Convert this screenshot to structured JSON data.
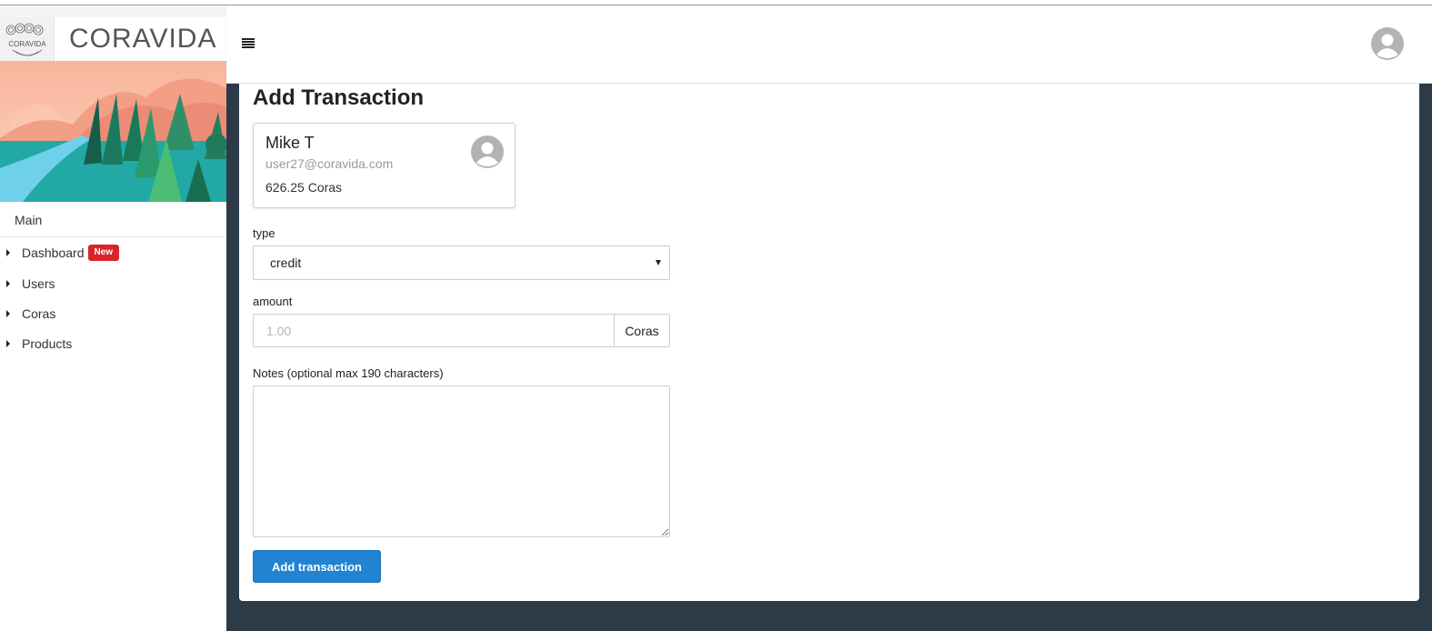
{
  "brand": {
    "title": "CORAVIDA",
    "logo_text": "CORAVIDA"
  },
  "sidebar": {
    "section_title": "Main",
    "items": [
      {
        "label": "Dashboard",
        "badge": "New"
      },
      {
        "label": "Users"
      },
      {
        "label": "Coras"
      },
      {
        "label": "Products"
      }
    ]
  },
  "header": {
    "menu_icon": "hamburger-icon",
    "avatar_icon": "user-avatar-icon"
  },
  "page": {
    "title": "Add Transaction",
    "user": {
      "name": "Mike T",
      "email": "user27@coravida.com",
      "balance": "626.25 Coras"
    },
    "form": {
      "type_label": "type",
      "type_value": "credit",
      "amount_label": "amount",
      "amount_placeholder": "1.00",
      "amount_unit": "Coras",
      "notes_label": "Notes (optional max 190 characters)",
      "submit_label": "Add transaction"
    }
  },
  "colors": {
    "accent": "#2183d1",
    "badge": "#d9232d",
    "background": "#2d3a48"
  }
}
